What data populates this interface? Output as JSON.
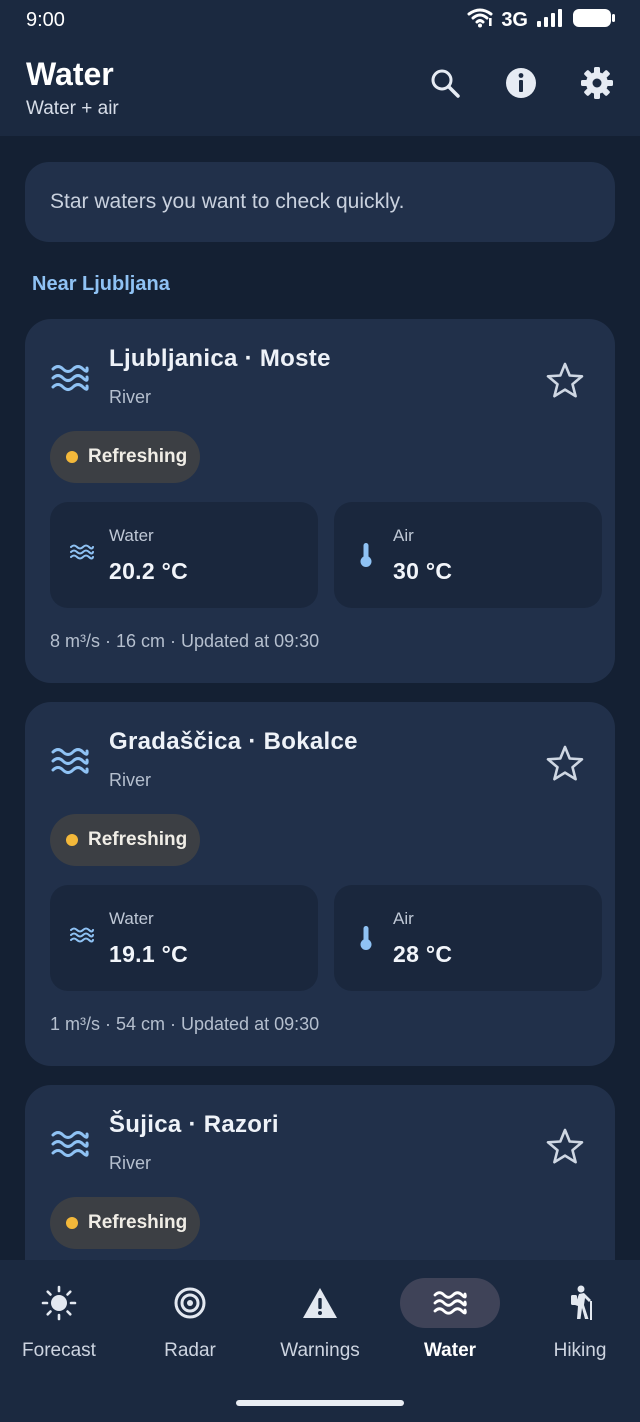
{
  "status_bar": {
    "time": "9:00",
    "network": "3G"
  },
  "app_bar": {
    "title": "Water",
    "subtitle": "Water + air"
  },
  "hint": "Star waters you want to check quickly.",
  "section_title": "Near Ljubljana",
  "cards": [
    {
      "title": "Ljubljanica · Moste",
      "type": "River",
      "status": "Refreshing",
      "water_label": "Water",
      "water_value": "20.2 °C",
      "air_label": "Air",
      "air_value": "30 °C",
      "footer": "8 m³/s · 16 cm · Updated at 09:30",
      "starred": false
    },
    {
      "title": "Gradaščica · Bokalce",
      "type": "River",
      "status": "Refreshing",
      "water_label": "Water",
      "water_value": "19.1 °C",
      "air_label": "Air",
      "air_value": "28 °C",
      "footer": "1 m³/s · 54 cm · Updated at 09:30",
      "starred": false
    },
    {
      "title": "Šujica · Razori",
      "type": "River",
      "status": "Refreshing",
      "starred": false
    }
  ],
  "nav": [
    {
      "label": "Forecast",
      "icon": "sun-icon",
      "active": false
    },
    {
      "label": "Radar",
      "icon": "radar-icon",
      "active": false
    },
    {
      "label": "Warnings",
      "icon": "warning-icon",
      "active": false
    },
    {
      "label": "Water",
      "icon": "waves-icon",
      "active": true
    },
    {
      "label": "Hiking",
      "icon": "hiking-icon",
      "active": false
    }
  ],
  "colors": {
    "background": "#142033",
    "card": "#21304a",
    "accent": "#8fc2f4",
    "status_dot": "#f3b83a"
  }
}
